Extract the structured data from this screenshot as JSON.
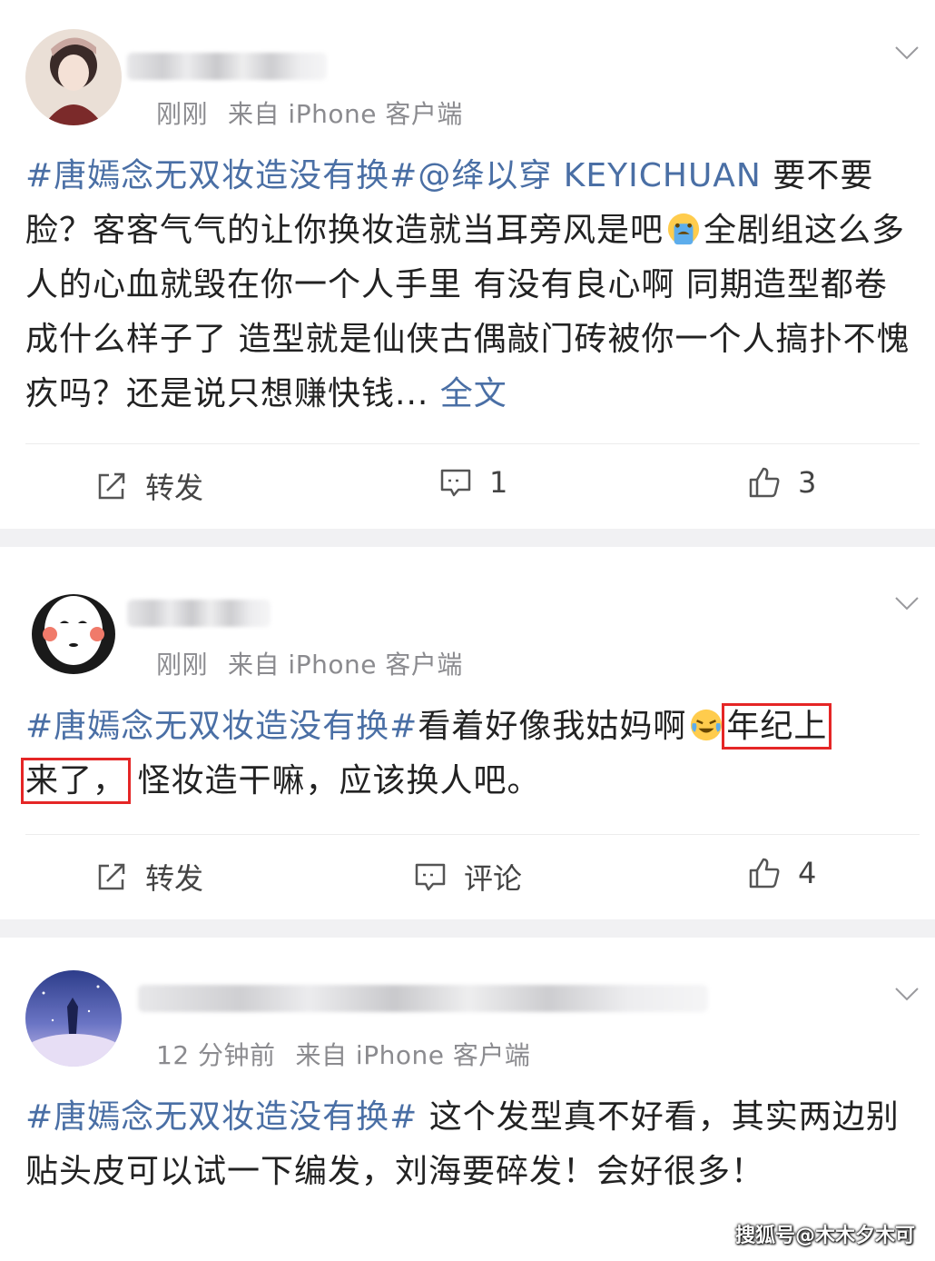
{
  "posts": [
    {
      "time": "刚刚",
      "source": "来自 iPhone 客户端",
      "hashtag": "#唐嫣念无双妆造没有换#",
      "mention": "@绛以穿 KEYICHUAN",
      "text_1": " 要不要脸？客客气气的让你换妆造就当耳旁风是吧",
      "emoji": "sweat-tears-emoji",
      "text_2": "全剧组这么多人的心血就毁在你一个人手里 有没有良心啊 同期造型都卷成什么样子了 造型就是仙侠古偶敲门砖被你一个人搞扑不愧疚吗？还是说只想赚快钱...",
      "more": " 全文",
      "repost_label": "转发",
      "comment_label": "1",
      "like_label": "3"
    },
    {
      "time": "刚刚",
      "source": "来自 iPhone 客户端",
      "hashtag": "#唐嫣念无双妆造没有换#",
      "text_1": "看着好像我姑妈啊",
      "emoji": "crying-laughing-emoji",
      "boxed_1": "年纪上",
      "boxed_2": "来了，",
      "text_2": " 怪妆造干嘛，应该换人吧。",
      "repost_label": "转发",
      "comment_label": "评论",
      "like_label": "4"
    },
    {
      "time": "12 分钟前",
      "source": "来自 iPhone 客户端",
      "hashtag": "#唐嫣念无双妆造没有换#",
      "text_1": " 这个发型真不好看，其实两边别贴头皮可以试一下编发，刘海要碎发！会好很多！"
    }
  ],
  "watermark": "搜狐号@木木夕木可",
  "colors": {
    "link": "#4a6fa5",
    "highlight_box": "#e52626",
    "separator": "#f1f1f3"
  }
}
